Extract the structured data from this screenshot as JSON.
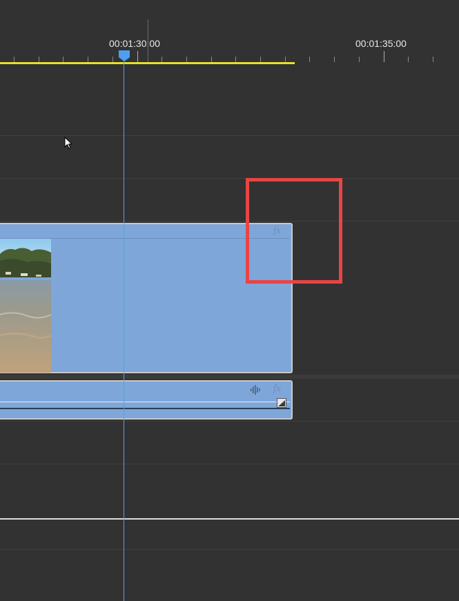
{
  "ruler": {
    "timecode_left": "00:01:30:00",
    "timecode_right": "00:01:35:00"
  },
  "clips": {
    "video_fx_label": "fx",
    "audio_fx_label": "fx"
  },
  "icons": {
    "cursor": "mouse-pointer-icon",
    "playhead": "playhead-marker-icon",
    "waveform": "audio-waveform-icon",
    "keyframe": "keyframe-toggle-icon"
  },
  "colors": {
    "in_out_bar": "#e8e02a",
    "playhead": "#5b9ee6",
    "clip": "#7ea6d8",
    "highlight": "#e84545"
  }
}
